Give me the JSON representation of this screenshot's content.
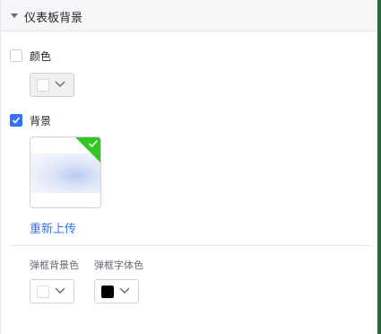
{
  "panel": {
    "title": "仪表板背景",
    "color": {
      "label": "颜色",
      "checked": false,
      "swatch": "#ffffff",
      "disabled": true
    },
    "background": {
      "label": "背景",
      "checked": true,
      "reupload_label": "重新上传"
    },
    "popup_bg_color": {
      "label": "弹框背景色",
      "swatch": "#ffffff"
    },
    "popup_font_color": {
      "label": "弹框字体色",
      "swatch": "#000000"
    }
  },
  "colors": {
    "accent": "#3370ff",
    "selected_corner": "#34c724",
    "edge": "#1e6b34"
  }
}
